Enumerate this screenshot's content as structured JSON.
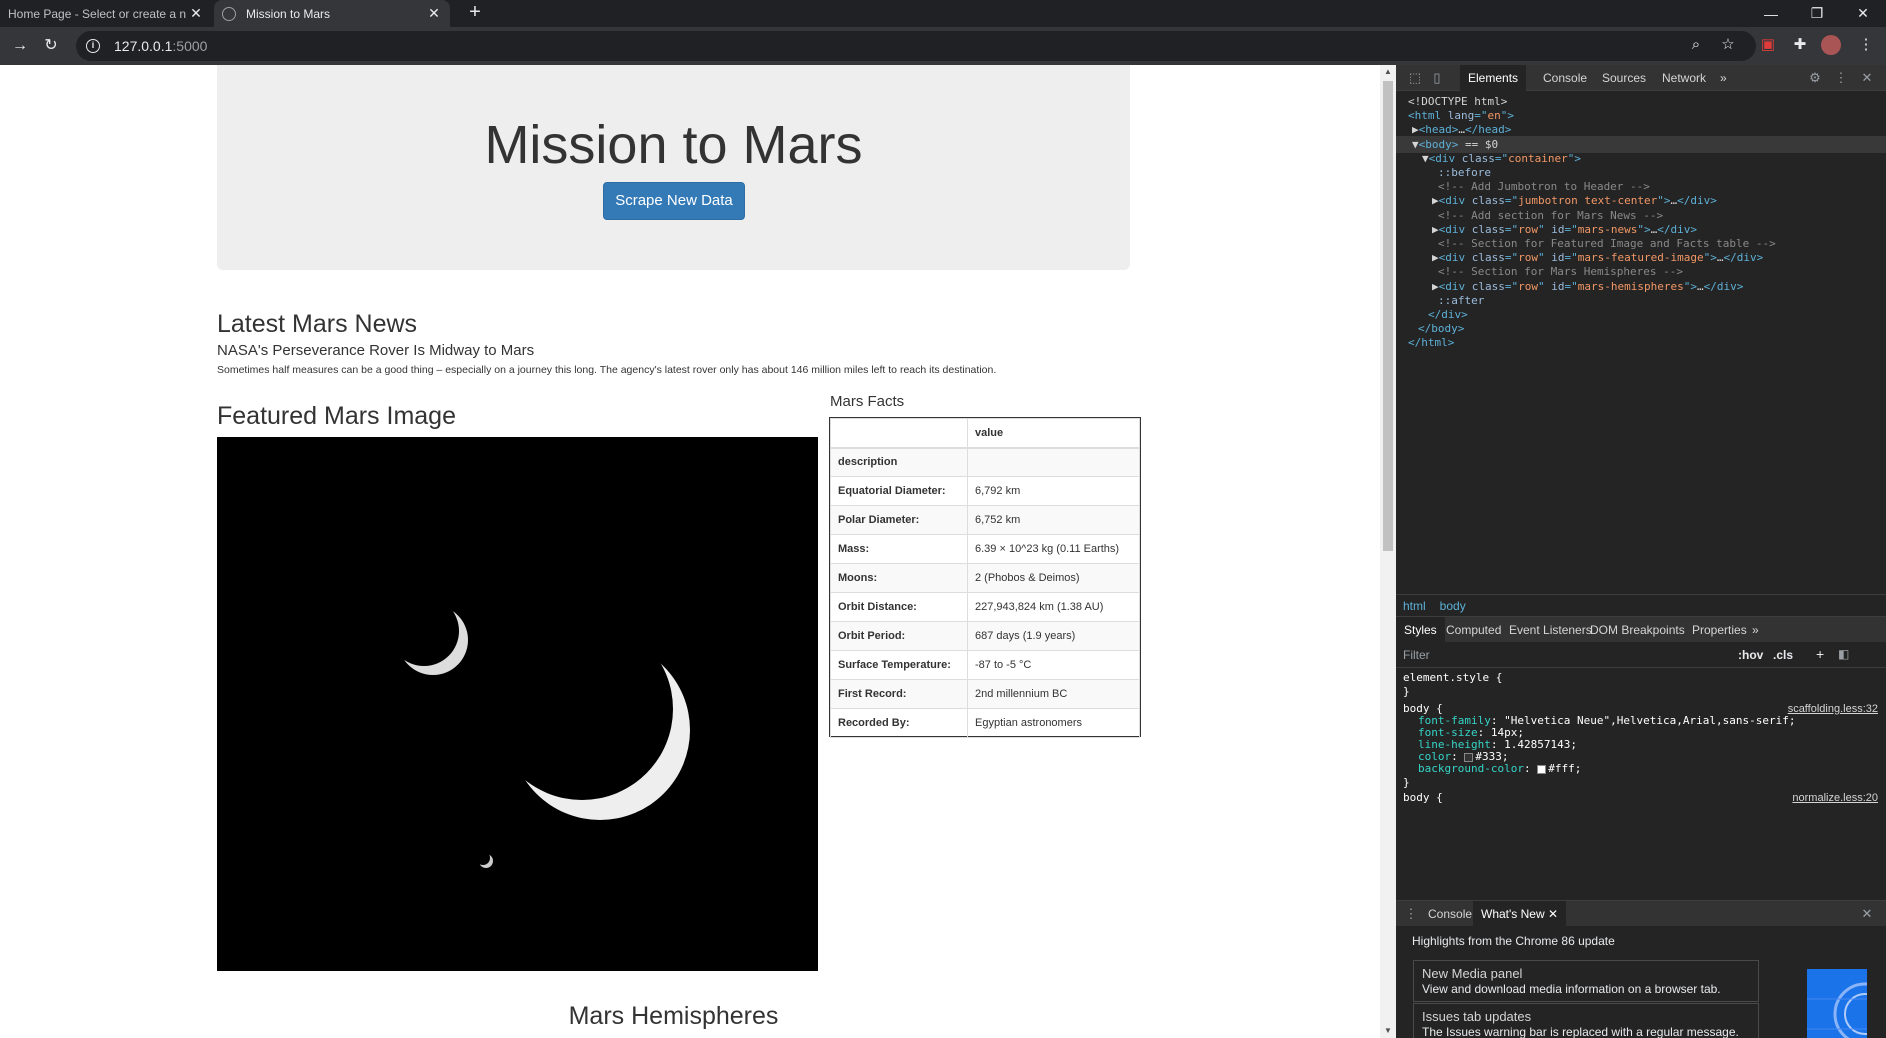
{
  "browser": {
    "tabs": [
      {
        "title": "Home Page - Select or create a n",
        "active": false
      },
      {
        "title": "Mission to Mars",
        "active": true
      }
    ],
    "new_tab_label": "+",
    "url": {
      "host": "127.0.0.1",
      "port": ":5000"
    },
    "window_controls": [
      "—",
      "❐",
      "✕"
    ]
  },
  "page": {
    "jumbotron": {
      "title": "Mission to Mars",
      "button": "Scrape New Data"
    },
    "news": {
      "heading": "Latest Mars News",
      "title": "NASA's Perseverance Rover Is Midway to Mars",
      "paragraph": "Sometimes half measures can be a good thing – especially on a journey this long. The agency's latest rover only has about 146 million miles left to reach its destination."
    },
    "featured": {
      "heading": "Featured Mars Image"
    },
    "facts": {
      "heading": "Mars Facts",
      "header_row": [
        "",
        "value"
      ],
      "rows": [
        [
          "description",
          ""
        ],
        [
          "Equatorial Diameter:",
          "6,792 km"
        ],
        [
          "Polar Diameter:",
          "6,752 km"
        ],
        [
          "Mass:",
          "6.39 × 10^23 kg (0.11 Earths)"
        ],
        [
          "Moons:",
          "2 (Phobos & Deimos)"
        ],
        [
          "Orbit Distance:",
          "227,943,824 km (1.38 AU)"
        ],
        [
          "Orbit Period:",
          "687 days (1.9 years)"
        ],
        [
          "Surface Temperature:",
          "-87 to -5 °C"
        ],
        [
          "First Record:",
          "2nd millennium BC"
        ],
        [
          "Recorded By:",
          "Egyptian astronomers"
        ]
      ]
    },
    "hemispheres": {
      "heading": "Mars Hemispheres"
    }
  },
  "devtools": {
    "tabs": [
      "Elements",
      "Console",
      "Sources",
      "Network"
    ],
    "more": "»",
    "dom": [
      [
        {
          "c": "t-plain",
          "t": "<!DOCTYPE html>"
        }
      ],
      [
        {
          "c": "t-tag",
          "t": "<html "
        },
        {
          "c": "t-attr",
          "t": "lang"
        },
        {
          "c": "t-tag",
          "t": "=\""
        },
        {
          "c": "t-val",
          "t": "en"
        },
        {
          "c": "t-tag",
          "t": "\">"
        }
      ],
      [
        {
          "c": "t-plain",
          "t": "▶"
        },
        {
          "c": "t-tag",
          "t": "<head>"
        },
        {
          "c": "t-plain",
          "t": "…"
        },
        {
          "c": "t-tag",
          "t": "</head>"
        }
      ],
      [
        {
          "c": "t-plain",
          "t": "▼"
        },
        {
          "c": "t-tag",
          "t": "<body>"
        },
        {
          "c": "t-plain",
          "t": " == $0"
        }
      ],
      [
        {
          "c": "t-plain",
          "t": "▼"
        },
        {
          "c": "t-tag",
          "t": "<div "
        },
        {
          "c": "t-attr",
          "t": "class"
        },
        {
          "c": "t-tag",
          "t": "=\""
        },
        {
          "c": "t-val",
          "t": "container"
        },
        {
          "c": "t-tag",
          "t": "\">"
        }
      ],
      [
        {
          "c": "t-pseudo",
          "t": "::before"
        }
      ],
      [
        {
          "c": "t-cmt",
          "t": "<!-- Add Jumbotron to Header -->"
        }
      ],
      [
        {
          "c": "t-plain",
          "t": "▶"
        },
        {
          "c": "t-tag",
          "t": "<div "
        },
        {
          "c": "t-attr",
          "t": "class"
        },
        {
          "c": "t-tag",
          "t": "=\""
        },
        {
          "c": "t-val",
          "t": "jumbotron text-center"
        },
        {
          "c": "t-tag",
          "t": "\">"
        },
        {
          "c": "t-plain",
          "t": "…"
        },
        {
          "c": "t-tag",
          "t": "</div>"
        }
      ],
      [
        {
          "c": "t-cmt",
          "t": "<!-- Add section for Mars News -->"
        }
      ],
      [
        {
          "c": "t-plain",
          "t": "▶"
        },
        {
          "c": "t-tag",
          "t": "<div "
        },
        {
          "c": "t-attr",
          "t": "class"
        },
        {
          "c": "t-tag",
          "t": "=\""
        },
        {
          "c": "t-val",
          "t": "row"
        },
        {
          "c": "t-tag",
          "t": "\" "
        },
        {
          "c": "t-attr",
          "t": "id"
        },
        {
          "c": "t-tag",
          "t": "=\""
        },
        {
          "c": "t-val",
          "t": "mars-news"
        },
        {
          "c": "t-tag",
          "t": "\">"
        },
        {
          "c": "t-plain",
          "t": "…"
        },
        {
          "c": "t-tag",
          "t": "</div>"
        }
      ],
      [
        {
          "c": "t-cmt",
          "t": "<!-- Section for Featured Image and Facts table -->"
        }
      ],
      [
        {
          "c": "t-plain",
          "t": "▶"
        },
        {
          "c": "t-tag",
          "t": "<div "
        },
        {
          "c": "t-attr",
          "t": "class"
        },
        {
          "c": "t-tag",
          "t": "=\""
        },
        {
          "c": "t-val",
          "t": "row"
        },
        {
          "c": "t-tag",
          "t": "\" "
        },
        {
          "c": "t-attr",
          "t": "id"
        },
        {
          "c": "t-tag",
          "t": "=\""
        },
        {
          "c": "t-val",
          "t": "mars-featured-image"
        },
        {
          "c": "t-tag",
          "t": "\">"
        },
        {
          "c": "t-plain",
          "t": "…"
        },
        {
          "c": "t-tag",
          "t": "</div>"
        }
      ],
      [
        {
          "c": "t-cmt",
          "t": "<!-- Section for Mars Hemispheres -->"
        }
      ],
      [
        {
          "c": "t-plain",
          "t": "▶"
        },
        {
          "c": "t-tag",
          "t": "<div "
        },
        {
          "c": "t-attr",
          "t": "class"
        },
        {
          "c": "t-tag",
          "t": "=\""
        },
        {
          "c": "t-val",
          "t": "row"
        },
        {
          "c": "t-tag",
          "t": "\" "
        },
        {
          "c": "t-attr",
          "t": "id"
        },
        {
          "c": "t-tag",
          "t": "=\""
        },
        {
          "c": "t-val",
          "t": "mars-hemispheres"
        },
        {
          "c": "t-tag",
          "t": "\">"
        },
        {
          "c": "t-plain",
          "t": "…"
        },
        {
          "c": "t-tag",
          "t": "</div>"
        }
      ],
      [
        {
          "c": "t-pseudo",
          "t": "::after"
        }
      ],
      [
        {
          "c": "t-tag",
          "t": "</div>"
        }
      ],
      [
        {
          "c": "t-tag",
          "t": "</body>"
        }
      ],
      [
        {
          "c": "t-tag",
          "t": "</html>"
        }
      ]
    ],
    "breadcrumbs": [
      "html",
      "body"
    ],
    "styles_tabs": [
      "Styles",
      "Computed",
      "Event Listeners",
      "DOM Breakpoints",
      "Properties"
    ],
    "filter_placeholder": "Filter",
    "filter_buttons": [
      ":hov",
      ".cls",
      "+"
    ],
    "styles": {
      "element_style": "element.style {",
      "close_brace": "}",
      "body_selector": "body {",
      "body_source": "scaffolding.less:32",
      "props": [
        [
          "font-family",
          "\"Helvetica Neue\",Helvetica,Arial,sans-serif;"
        ],
        [
          "font-size",
          "14px;"
        ],
        [
          "line-height",
          "1.42857143;"
        ],
        [
          "color",
          "#333;"
        ],
        [
          "background-color",
          "#fff;"
        ]
      ],
      "body2_selector": "body {",
      "body2_source": "normalize.less:20"
    },
    "drawer_tabs": [
      "Console",
      "What's New"
    ],
    "whats_new": {
      "heading": "Highlights from the Chrome 86 update",
      "cards": [
        {
          "title": "New Media panel",
          "desc": "View and download media information on a browser tab."
        },
        {
          "title": "Issues tab updates",
          "desc": "The Issues warning bar is replaced with a regular message. Issues tab has a new checkbox to filter third-party cookie issues."
        }
      ]
    }
  }
}
